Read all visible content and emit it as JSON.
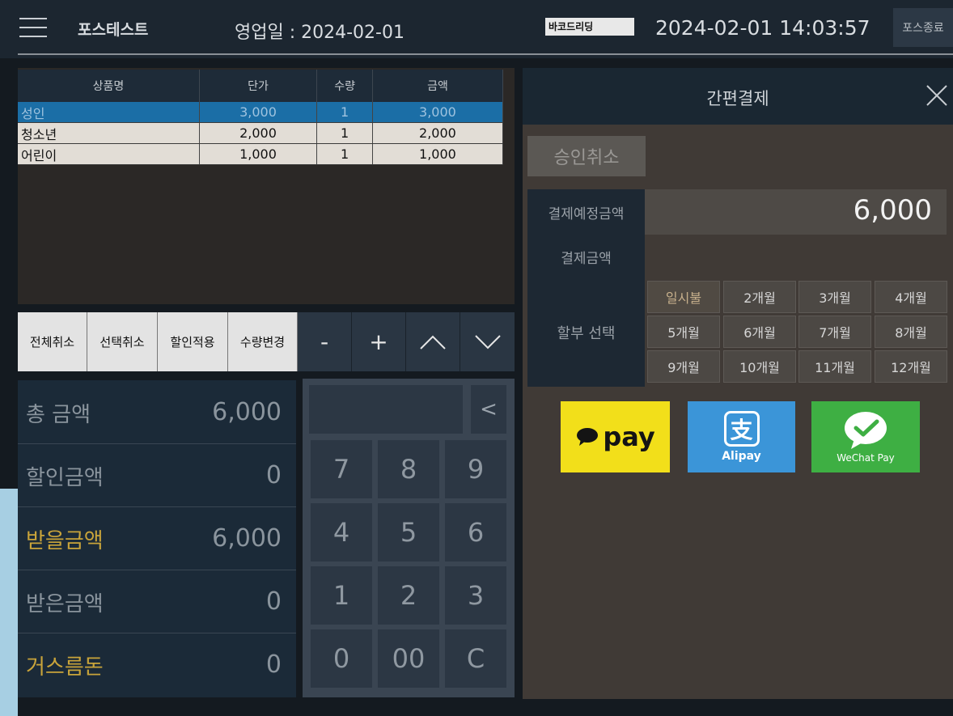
{
  "header": {
    "app_title": "포스테스트",
    "business_day": "영업일 : 2024-02-01",
    "barcode_reading": "바코드리딩",
    "datetime": "2024-02-01 14:03:57",
    "pos_exit": "포스종료"
  },
  "table": {
    "columns": [
      "상품명",
      "단가",
      "수량",
      "금액"
    ],
    "rows": [
      {
        "name": "성인",
        "price": "3,000",
        "qty": "1",
        "amount": "3,000",
        "selected": true
      },
      {
        "name": "청소년",
        "price": "2,000",
        "qty": "1",
        "amount": "2,000"
      },
      {
        "name": "어린이",
        "price": "1,000",
        "qty": "1",
        "amount": "1,000"
      }
    ]
  },
  "actions": {
    "cancel_all": "전체취소",
    "cancel_selected": "선택취소",
    "apply_discount": "할인적용",
    "change_qty": "수량변경",
    "minus": "-",
    "plus": "+"
  },
  "summary": {
    "total_label": "총 금액",
    "total_value": "6,000",
    "discount_label": "할인금액",
    "discount_value": "0",
    "receivable_label": "받을금액",
    "receivable_value": "6,000",
    "received_label": "받은금액",
    "received_value": "0",
    "change_label": "거스름돈",
    "change_value": "0"
  },
  "keypad": {
    "backspace": "<",
    "keys": [
      "7",
      "8",
      "9",
      "4",
      "5",
      "6",
      "1",
      "2",
      "3",
      "0",
      "00",
      "C"
    ]
  },
  "simple_pay": {
    "title": "간편결제",
    "cancel_approval": "승인취소",
    "due_label": "결제예정금액",
    "due_amount": "6,000",
    "paid_label": "결제금액",
    "installment_label": "할부 선택",
    "installments": [
      "일시불",
      "2개월",
      "3개월",
      "4개월",
      "5개월",
      "6개월",
      "7개월",
      "8개월",
      "9개월",
      "10개월",
      "11개월",
      "12개월"
    ],
    "kakao_label": "pay",
    "alipay_label": "Alipay",
    "alipay_glyph": "支",
    "wechat_label": "WeChat Pay"
  },
  "colors": {
    "kakao": "#f2df1a",
    "alipay": "#3b95d8",
    "wechat": "#3eaf43",
    "highlight_gold": "#c9a43a",
    "selected_row": "#1b6ea6"
  }
}
